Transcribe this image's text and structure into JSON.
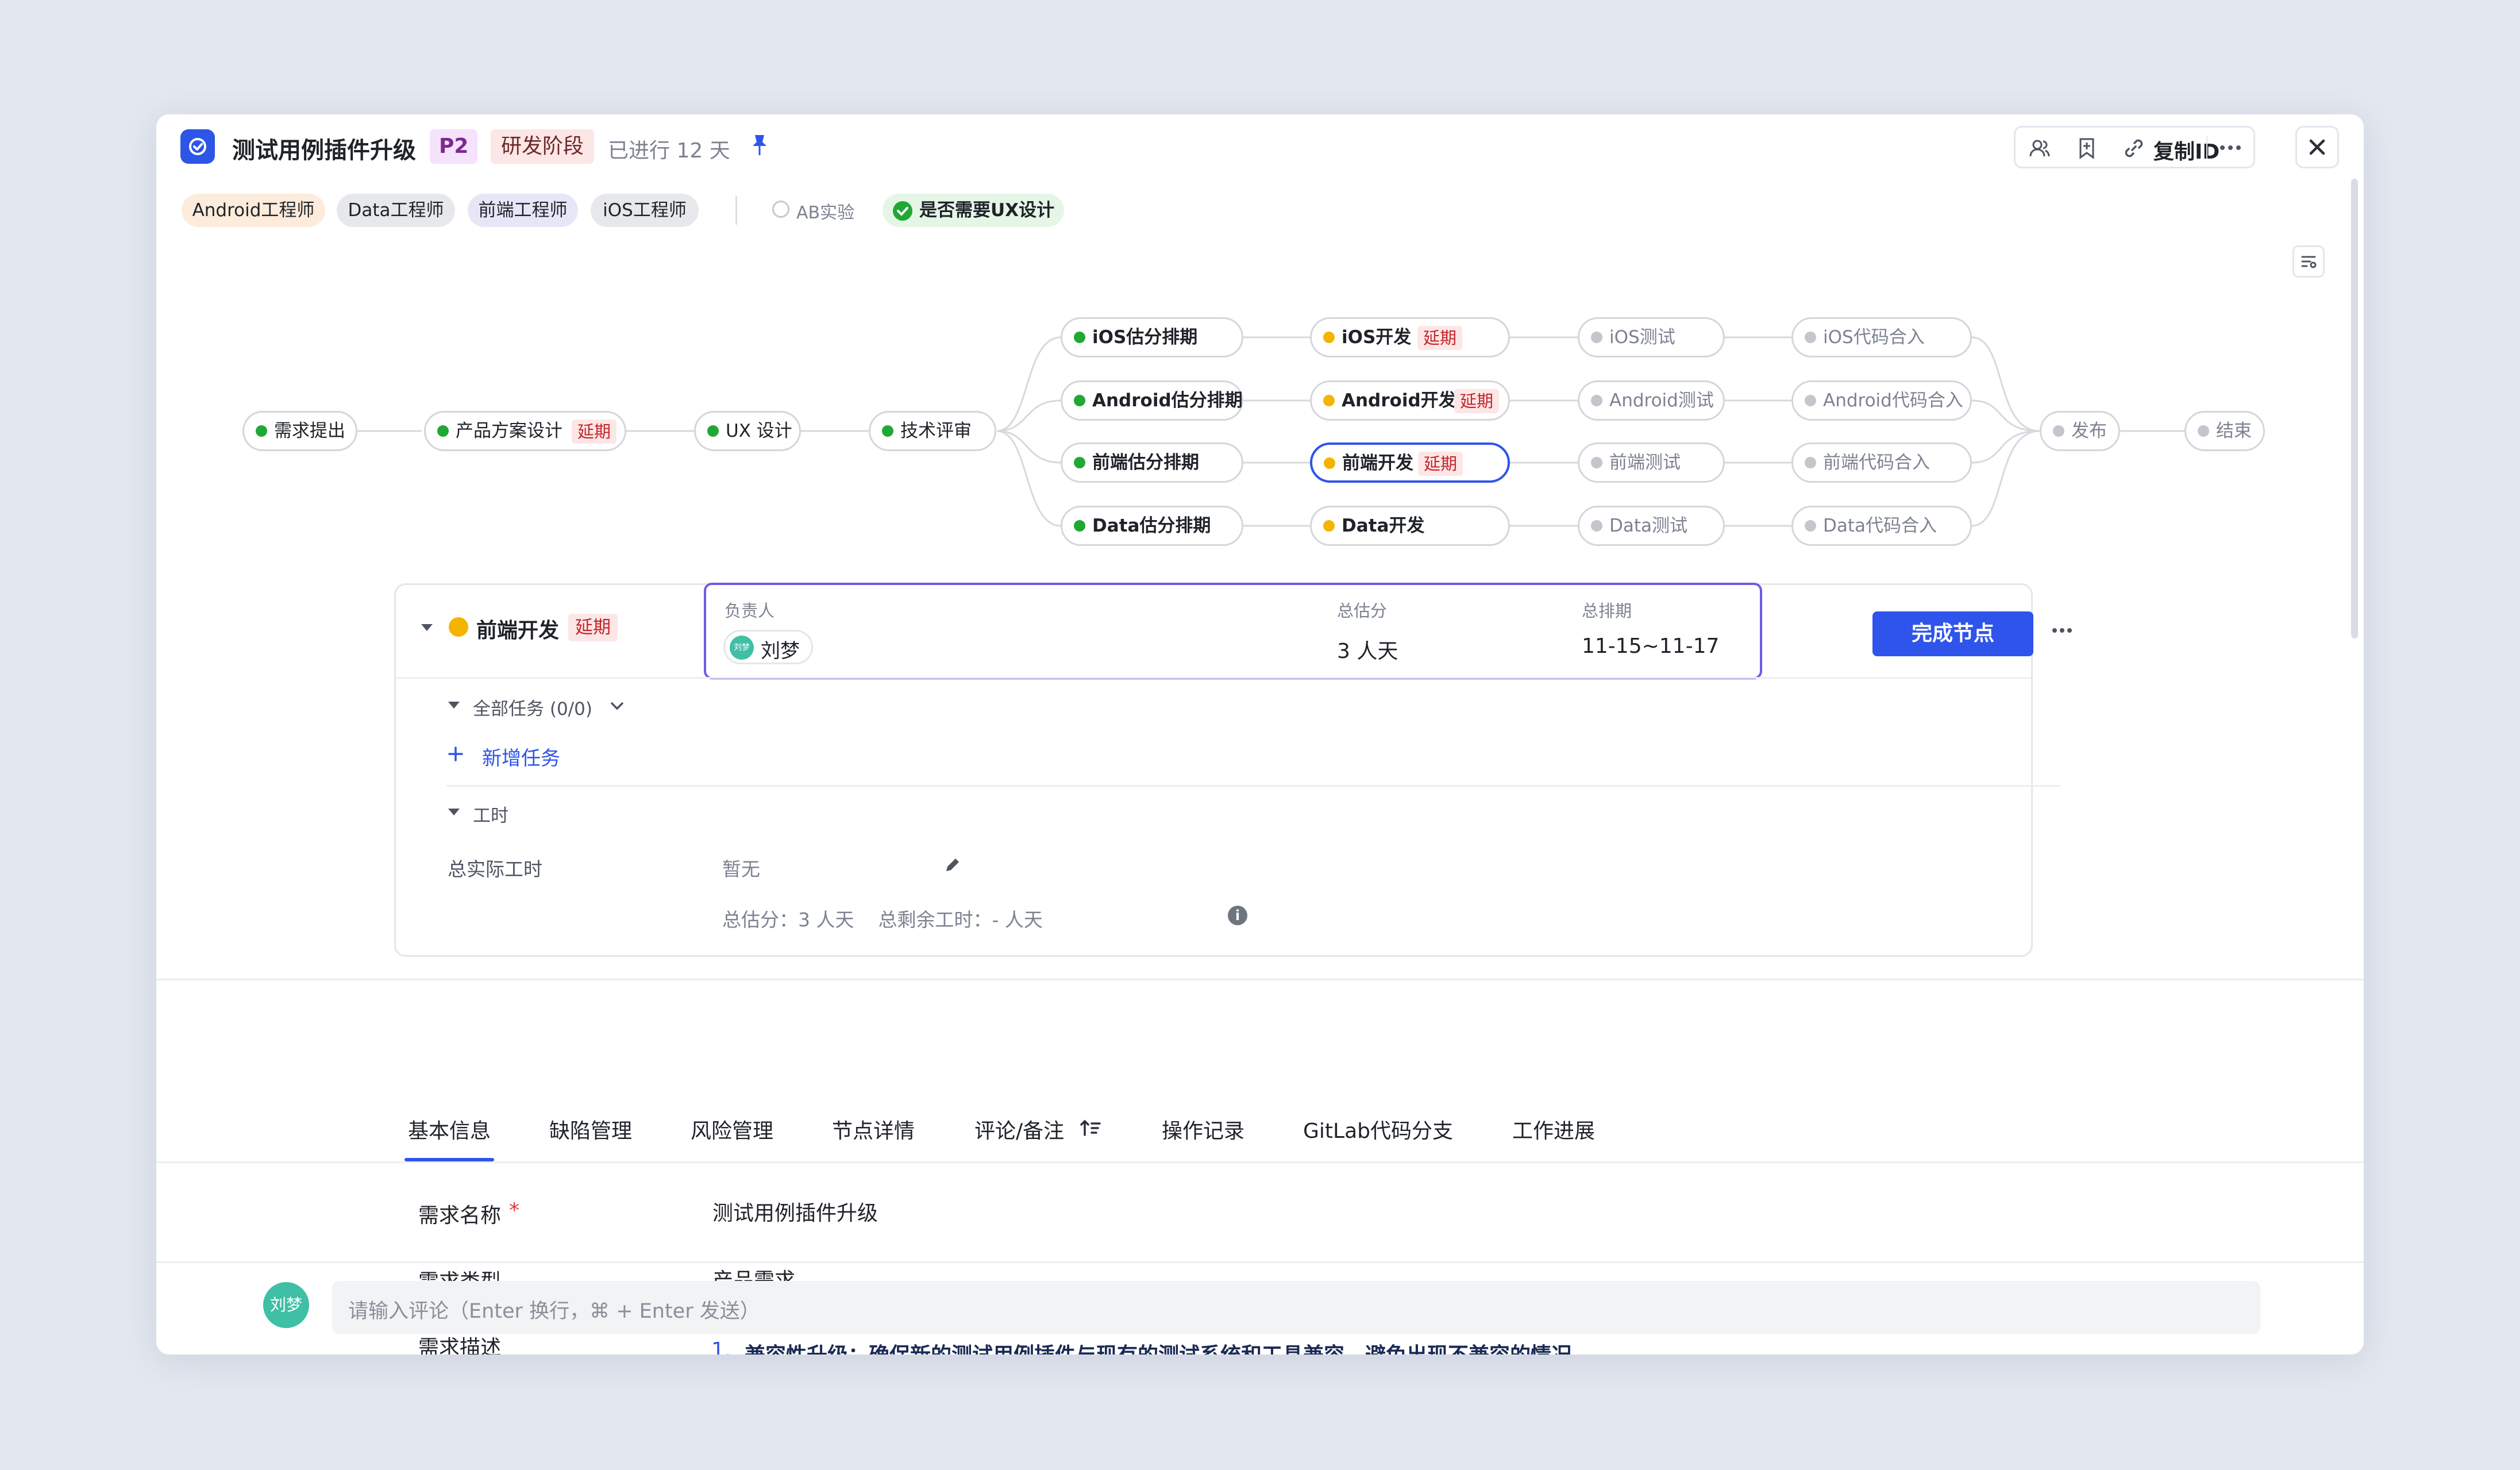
{
  "header": {
    "title": "测试用例插件升级",
    "priority": "P2",
    "stage": "研发阶段",
    "progress_text": "已进行 12 天",
    "copy_id_label": "复制ID"
  },
  "roles": [
    "Android工程师",
    "Data工程师",
    "前端工程师",
    "iOS工程师"
  ],
  "toggles": {
    "ab_label": "AB实验",
    "ux_label": "是否需要UX设计"
  },
  "workflow": {
    "delay_label": "延期",
    "main_nodes": [
      "需求提出",
      "产品方案设计",
      "UX 设计",
      "技术评审"
    ],
    "rows": [
      [
        "iOS估分排期",
        "iOS开发",
        "iOS测试",
        "iOS代码合入"
      ],
      [
        "Android估分排期",
        "Android开发",
        "Android测试",
        "Android代码合入"
      ],
      [
        "前端估分排期",
        "前端开发",
        "前端测试",
        "前端代码合入"
      ],
      [
        "Data估分排期",
        "Data开发",
        "Data测试",
        "Data代码合入"
      ]
    ],
    "end_nodes": [
      "发布",
      "结束"
    ]
  },
  "panel": {
    "node_name": "前端开发",
    "delay_label": "延期",
    "owner_label": "负责人",
    "owner_name": "刘梦",
    "owner_avatar": "刘梦",
    "estimate_label": "总估分",
    "estimate_value": "3 人天",
    "schedule_label": "总排期",
    "schedule_value": "11-15~11-17",
    "complete_button": "完成节点",
    "tasks_label": "全部任务 (0/0)",
    "add_task": "新增任务",
    "hours_section": "工时",
    "actual_hours_label": "总实际工时",
    "actual_hours_value": "暂无",
    "summary": "总估分：3 人天    总剩余工时：- 人天"
  },
  "tabs": [
    "基本信息",
    "缺陷管理",
    "风险管理",
    "节点详情",
    "评论/备注",
    "操作记录",
    "GitLab代码分支",
    "工作进展"
  ],
  "info": {
    "name_label": "需求名称",
    "name_value": "测试用例插件升级",
    "type_label": "需求类型",
    "type_value": "产品需求",
    "desc_label": "需求描述",
    "desc_index": "1.",
    "desc_value": "兼容性升级：确保新的测试用例插件与现有的测试系统和工具兼容，避免出现不兼容的情况。"
  },
  "comment": {
    "avatar_text": "刘梦",
    "placeholder": "请输入评论（Enter 换行，⌘ + Enter 发送）"
  },
  "colors": {
    "accent": "#2f54eb",
    "status_done": "#21a834",
    "status_progress": "#f5b400",
    "status_todo": "#c3c6cc",
    "delay": "#c1262c"
  }
}
